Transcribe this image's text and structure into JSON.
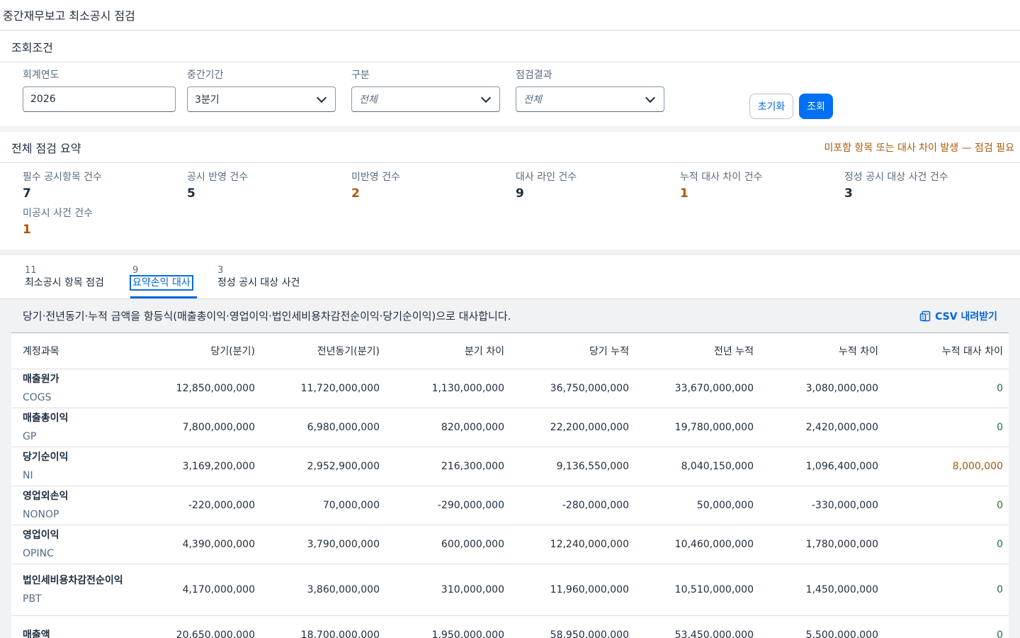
{
  "app": {
    "title": "중간재무보고 최소공시 점검"
  },
  "filters": {
    "title": "조회조건",
    "fiscal_year": {
      "label": "회계연도",
      "value": "2026"
    },
    "interim_period": {
      "label": "중간기간",
      "value": "3분기"
    },
    "category": {
      "label": "구분",
      "placeholder": "전체"
    },
    "result": {
      "label": "점검결과",
      "placeholder": "전체"
    },
    "reset_label": "초기화",
    "search_label": "조회"
  },
  "summary": {
    "title": "전체 점검 요약",
    "warning": "미포함 항목 또는 대사 차이 발생 — 점검 필요",
    "kpis": [
      {
        "label": "필수 공시항목 건수",
        "value": "7"
      },
      {
        "label": "공시 반영 건수",
        "value": "5"
      },
      {
        "label": "미반영 건수",
        "value": "2"
      },
      {
        "label": "대사 라인 건수",
        "value": "9"
      },
      {
        "label": "누적 대사 차이 건수",
        "value": "1"
      },
      {
        "label": "정성 공시 대상 사건 건수",
        "value": "3"
      },
      {
        "label": "미공시 사건 건수",
        "value": "1"
      }
    ]
  },
  "tabs": [
    {
      "count": "11",
      "label": "최소공시 항목 점검"
    },
    {
      "count": "9",
      "label": "요약손익 대사"
    },
    {
      "count": "3",
      "label": "정성 공시 대상 사건"
    }
  ],
  "table": {
    "description": "당기·전년동기·누적 금액을 항등식(매출총이익·영업이익·법인세비용차감전순이익·당기순이익)으로 대사합니다.",
    "csv_label": "CSV 내려받기",
    "columns": [
      "계정과목",
      "당기(분기)",
      "전년동기(분기)",
      "분기 차이",
      "당기 누적",
      "전년 누적",
      "누적 차이",
      "누적 대사 차이"
    ],
    "rows": [
      {
        "name": "매출원가",
        "code": "COGS",
        "values": [
          "12,850,000,000",
          "11,720,000,000",
          "1,130,000,000",
          "36,750,000,000",
          "33,670,000,000",
          "3,080,000,000"
        ],
        "diff": "0"
      },
      {
        "name": "매출총이익",
        "code": "GP",
        "values": [
          "7,800,000,000",
          "6,980,000,000",
          "820,000,000",
          "22,200,000,000",
          "19,780,000,000",
          "2,420,000,000"
        ],
        "diff": "0"
      },
      {
        "name": "당기순이익",
        "code": "NI",
        "values": [
          "3,169,200,000",
          "2,952,900,000",
          "216,300,000",
          "9,136,550,000",
          "8,040,150,000",
          "1,096,400,000"
        ],
        "diff": "8,000,000"
      },
      {
        "name": "영업외손익",
        "code": "NONOP",
        "values": [
          "-220,000,000",
          "70,000,000",
          "-290,000,000",
          "-280,000,000",
          "50,000,000",
          "-330,000,000"
        ],
        "diff": "0"
      },
      {
        "name": "영업이익",
        "code": "OPINC",
        "values": [
          "4,390,000,000",
          "3,790,000,000",
          "600,000,000",
          "12,240,000,000",
          "10,460,000,000",
          "1,780,000,000"
        ],
        "diff": "0"
      },
      {
        "name": "법인세비용차감전순이익",
        "code": "PBT",
        "values": [
          "4,170,000,000",
          "3,860,000,000",
          "310,000,000",
          "11,960,000,000",
          "10,510,000,000",
          "1,450,000,000"
        ],
        "diff": "0"
      },
      {
        "name": "매출액",
        "code": "",
        "values": [
          "20,650,000,000",
          "18,700,000,000",
          "1,950,000,000",
          "58,950,000,000",
          "53,450,000,000",
          "5,500,000,000"
        ],
        "diff": "0"
      }
    ]
  }
}
